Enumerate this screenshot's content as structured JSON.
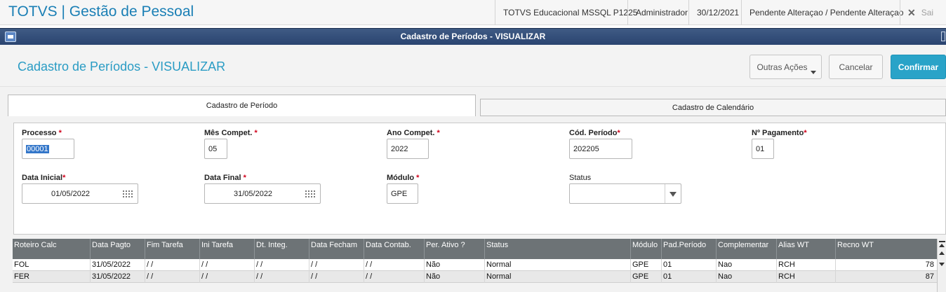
{
  "app": {
    "title": "TOTVS | Gestão de Pessoal"
  },
  "topbar": {
    "environment": "TOTVS Educacional MSSQL P1225",
    "user": "Administrador",
    "date": "30/12/2021",
    "status": "Pendente Alteraçao / Pendente Alteraçao",
    "exit_label": "Sai"
  },
  "window": {
    "title": "Cadastro de Períodos - VISUALIZAR"
  },
  "header": {
    "title": "Cadastro de Períodos - VISUALIZAR",
    "more_actions_label": "Outras Ações",
    "cancel_label": "Cancelar",
    "confirm_label": "Confirmar"
  },
  "tabs": [
    {
      "label": "Cadastro de Período",
      "active": true
    },
    {
      "label": "Cadastro de Calendário",
      "active": false
    }
  ],
  "form": {
    "processo": {
      "label": "Processo",
      "value": "00001"
    },
    "mes_compet": {
      "label": "Mês Compet.",
      "value": "05"
    },
    "ano_compet": {
      "label": "Ano Compet.",
      "value": "2022"
    },
    "cod_periodo": {
      "label": "Cód. Período",
      "value": "202205"
    },
    "num_pagamento": {
      "label": "Nº Pagamento",
      "value": "01"
    },
    "data_inicial": {
      "label": "Data Inicial",
      "value": "01/05/2022"
    },
    "data_final": {
      "label": "Data Final",
      "value": "31/05/2022"
    },
    "modulo": {
      "label": "Módulo",
      "value": "GPE"
    },
    "status": {
      "label": "Status",
      "value": ""
    },
    "required_mark": "*"
  },
  "grid": {
    "columns": [
      "Roteiro Calc",
      "Data Pagto",
      "Fim Tarefa",
      "Ini Tarefa",
      "Dt. Integ.",
      "Data Fecham",
      "Data Contab.",
      "Per. Ativo ?",
      "Status",
      "Módulo",
      "Pad.Período",
      "Complementar",
      "Alias WT",
      "Recno WT"
    ],
    "rows": [
      [
        "FOL",
        "31/05/2022",
        " / /",
        " / /",
        " / /",
        " / /",
        " / /",
        "Não",
        "Normal",
        "GPE",
        "01",
        "Nao",
        "RCH",
        "78"
      ],
      [
        "FER",
        "31/05/2022",
        " / /",
        " / /",
        " / /",
        " / /",
        " / /",
        "Não",
        "Normal",
        "GPE",
        "01",
        "Nao",
        "RCH",
        "87"
      ]
    ]
  },
  "icons": {
    "calendar": "calendar-icon",
    "dropdown": "chevron-down-icon",
    "window": "window-icon",
    "close": "close-icon"
  },
  "colors": {
    "brand": "#1a7fb5",
    "accent": "#29a3c8",
    "required": "#d0021b",
    "grid_header": "#6d7376"
  }
}
